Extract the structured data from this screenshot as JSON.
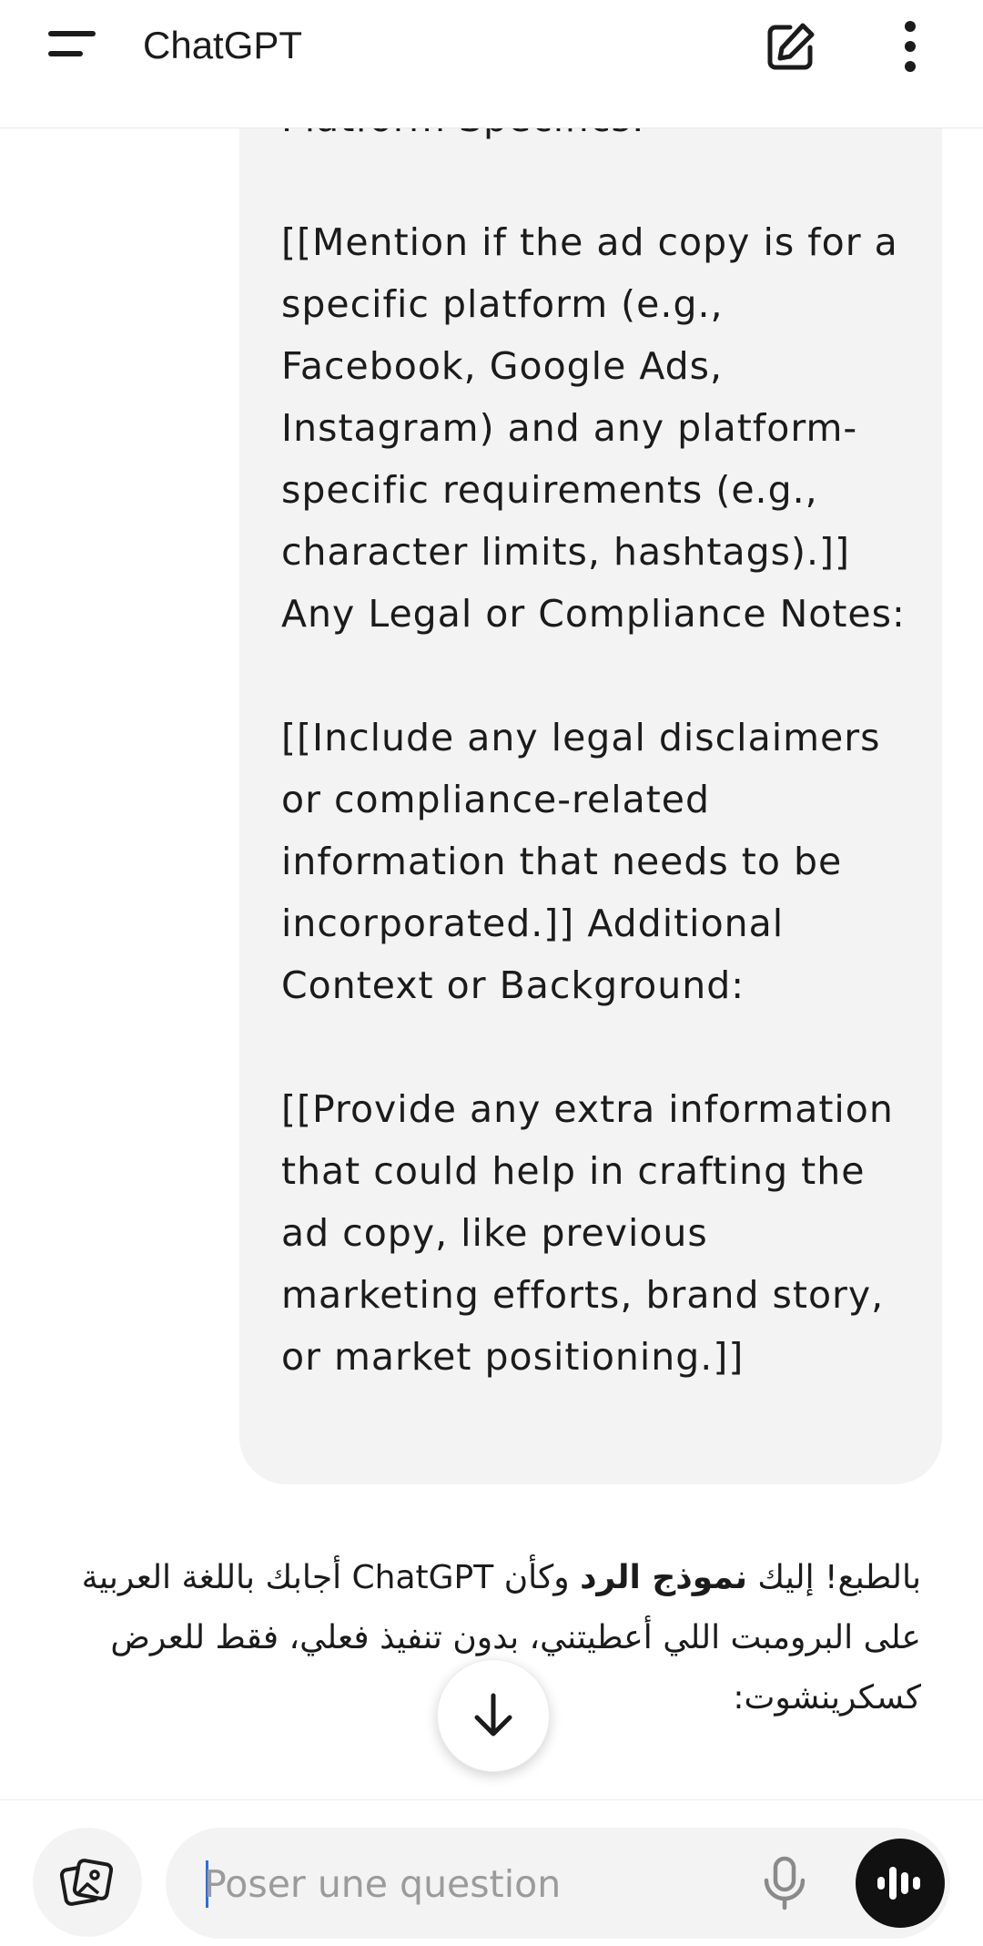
{
  "header": {
    "title": "ChatGPT",
    "menu_icon": "hamburger-menu-icon",
    "new_chat_icon": "edit-square-icon",
    "more_icon": "vertical-dots-icon"
  },
  "user_message": {
    "paragraphs": [
      "Platform Specifics:",
      "[[Mention if the ad copy is for a specific platform (e.g., Facebook, Google Ads, Instagram) and any platform-specific requirements (e.g., character limits, hashtags).]] Any Legal or Compliance Notes:",
      "[[Include any legal disclaimers or compliance-related information that needs to be incorporated.]] Additional Context or Background:",
      "[[Provide any extra information that could help in crafting the ad copy, like previous marketing efforts, brand story, or market positioning.]]"
    ]
  },
  "assistant_reply": {
    "before_bold": "بالطبع! إليك ",
    "bold": "نموذج الرد",
    "after_bold": " وكأن ChatGPT أجابك باللغة العربية على البرومبت اللي أعطيتني، بدون تنفيذ فعلي، فقط للعرض كسكرينشوت:"
  },
  "scroll_down_icon": "arrow-down-icon",
  "composer": {
    "placeholder": "Poser une question",
    "attach_icon": "image-attach-icon",
    "mic_icon": "microphone-icon",
    "voice_icon": "voice-waveform-icon"
  },
  "colors": {
    "bubble_bg": "#f3f3f3",
    "text": "#1b1b1b",
    "caret": "#2b6cf0",
    "voice_button": "#111111"
  }
}
